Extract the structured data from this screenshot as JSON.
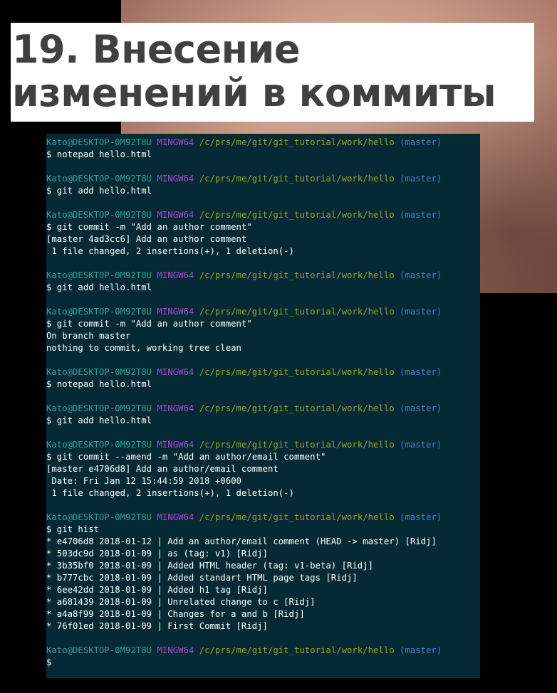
{
  "title": {
    "line1": "19. Внесение",
    "line2": "изменений в коммиты"
  },
  "prompt": {
    "user": "Kato@DESKTOP-0M92T8U",
    "shell": "MINGW64",
    "path": "/c/prs/me/git/git_tutorial/work/hello",
    "branch": "(master)"
  },
  "blocks": [
    {
      "lines": [
        "$ notepad hello.html"
      ]
    },
    {
      "lines": [
        "$ git add hello.html"
      ]
    },
    {
      "lines": [
        "$ git commit -m \"Add an author comment\"",
        "[master 4ad3cc6] Add an author comment",
        " 1 file changed, 2 insertions(+), 1 deletion(-)"
      ]
    },
    {
      "lines": [
        "$ git add hello.html"
      ]
    },
    {
      "lines": [
        "$ git commit -m \"Add an author comment\"",
        "On branch master",
        "nothing to commit, working tree clean"
      ]
    },
    {
      "lines": [
        "$ notepad hello.html"
      ]
    },
    {
      "lines": [
        "$ git add hello.html"
      ]
    },
    {
      "lines": [
        "$ git commit --amend -m \"Add an author/email comment\"",
        "[master e4706d8] Add an author/email comment",
        " Date: Fri Jan 12 15:44:59 2018 +0600",
        " 1 file changed, 2 insertions(+), 1 deletion(-)"
      ]
    },
    {
      "lines": [
        "$ git hist",
        "* e4706d8 2018-01-12 | Add an author/email comment (HEAD -> master) [Ridj]",
        "* 503dc9d 2018-01-09 | as (tag: v1) [Ridj]",
        "* 3b35bf0 2018-01-09 | Added HTML header (tag: v1-beta) [Ridj]",
        "* b777cbc 2018-01-09 | Added standart HTML page tags [Ridj]",
        "* 6ee42dd 2018-01-09 | Added h1 tag [Ridj]",
        "* a681439 2018-01-09 | Unrelated change to c [Ridj]",
        "* a4a8f99 2018-01-09 | Changes for a and b [Ridj]",
        "* 76f01ed 2018-01-09 | First Commit [Ridj]"
      ]
    },
    {
      "lines": [
        "$"
      ]
    }
  ]
}
